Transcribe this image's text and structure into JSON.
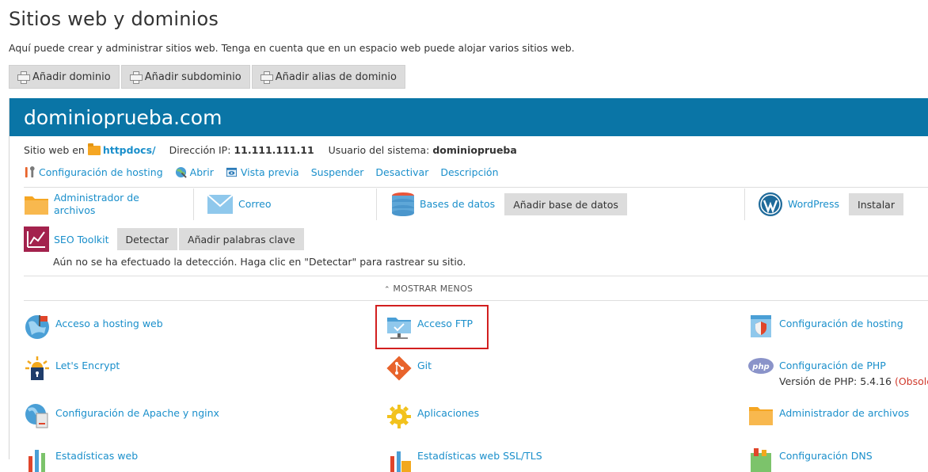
{
  "page": {
    "title": "Sitios web y dominios",
    "description": "Aquí puede crear y administrar sitios web. Tenga en cuenta que en un espacio web puede alojar varios sitios web."
  },
  "top_buttons": {
    "add_domain": "Añadir dominio",
    "add_subdomain": "Añadir subdominio",
    "add_alias": "Añadir alias de dominio"
  },
  "domain": {
    "name": "dominioprueba.com",
    "site_label": "Sitio web en",
    "site_folder": "httpdocs/",
    "ip_label": "Dirección IP:",
    "ip_value": "11.111.111.11",
    "user_label": "Usuario del sistema:",
    "user_value": "dominioprueba"
  },
  "actions": {
    "hosting_config": "Configuración de hosting",
    "open": "Abrir",
    "preview": "Vista previa",
    "suspend": "Suspender",
    "deactivate": "Desactivar",
    "description": "Descripción"
  },
  "tools": {
    "file_manager_line1": "Administrador de",
    "file_manager_line2": "archivos",
    "mail": "Correo",
    "databases": "Bases de datos",
    "add_database": "Añadir base de datos",
    "wordpress": "WordPress",
    "install": "Instalar"
  },
  "seo": {
    "label": "SEO Toolkit",
    "detect": "Detectar",
    "add_keywords": "Añadir palabras clave",
    "note": "Aún no se ha efectuado la detección. Haga clic en \"Detectar\" para rastrear su sitio."
  },
  "show_less": "MOSTRAR MENOS",
  "grid": {
    "hosting_access": "Acceso a hosting web",
    "ftp_access": "Acceso FTP",
    "hosting_settings": "Configuración de hosting",
    "lets_encrypt": "Let's Encrypt",
    "git": "Git",
    "php_settings": "Configuración de PHP",
    "php_version_label": "Versión de PHP: 5.4.16",
    "php_obsolete": "(Obsolet",
    "apache_nginx": "Configuración de Apache y nginx",
    "applications": "Aplicaciones",
    "file_manager": "Administrador de archivos",
    "web_stats": "Estadísticas web",
    "ssl_stats": "Estadísticas web SSL/TLS",
    "dns_settings": "Configuración DNS"
  },
  "colors": {
    "header_bg": "#0a75a6",
    "link": "#1a8fcb",
    "highlight": "#d21f1f",
    "obsolete": "#d0392b"
  }
}
